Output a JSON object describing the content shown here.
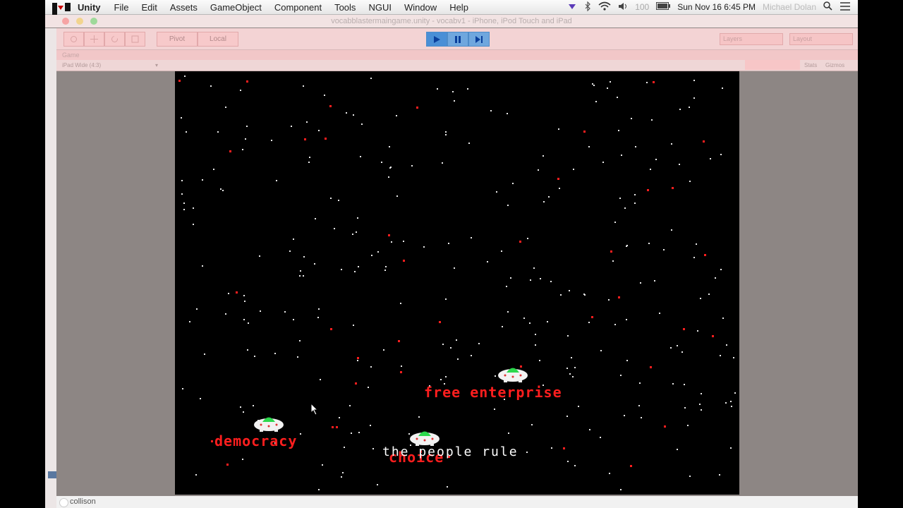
{
  "menubar": {
    "app": "Unity",
    "menus": [
      "File",
      "Edit",
      "Assets",
      "GameObject",
      "Component",
      "Tools",
      "NGUI",
      "Window",
      "Help"
    ],
    "battery": "100",
    "clock": "Sun Nov 16  6:45 PM",
    "user": "Michael Dolan"
  },
  "window": {
    "title": "vocabblastermaingame.unity - vocabv1 - iPhone, iPod Touch and iPad"
  },
  "toolbar": {
    "pivot_label": "Pivot",
    "space_label": "Local",
    "layers_label": "Layers",
    "layout_label": "Layout"
  },
  "game_panel": {
    "tab_label": "Game",
    "aspect": "iPad Wide (4:3)",
    "stats_label": "Stats",
    "gizmos_label": "Gizmos"
  },
  "game": {
    "words": {
      "democracy": "democracy",
      "free_enterprise": "free enterprise",
      "choice": "choice",
      "definition": "the people rule"
    },
    "colors": {
      "word_red": "#ff1e1e",
      "definition_white": "#ffffff",
      "background": "#000000"
    }
  },
  "status": {
    "text": "collison"
  }
}
